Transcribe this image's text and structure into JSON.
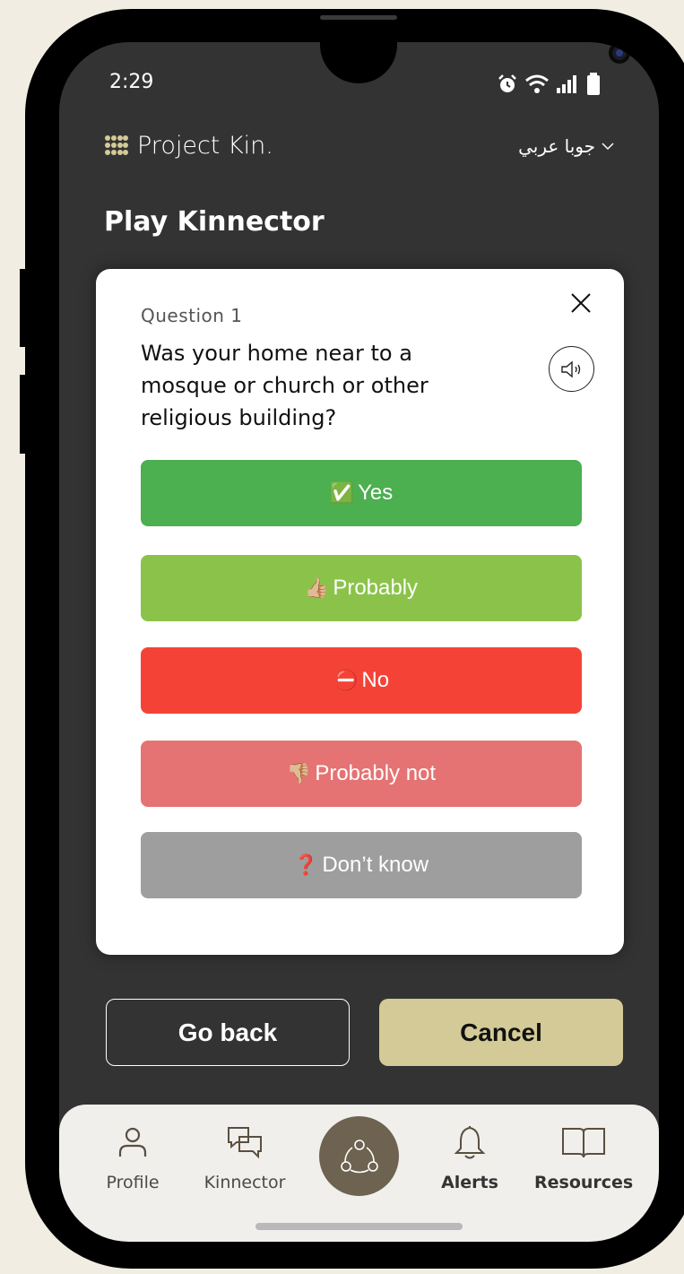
{
  "status_bar": {
    "time": "2:29",
    "icons": [
      "alarm-icon",
      "wifi-icon",
      "signal-icon",
      "battery-icon"
    ]
  },
  "header": {
    "brand": "Project Kin.",
    "language": "جوبا عربي"
  },
  "page": {
    "title": "Play Kinnector"
  },
  "question_card": {
    "label": "Question 1",
    "text": "Was your home near to a mosque or church or other religious building?",
    "answers": [
      {
        "emoji": "✅",
        "label": "Yes",
        "color": "#4caf50"
      },
      {
        "emoji": "👍🏼",
        "label": "Probably",
        "color": "#8bc34a"
      },
      {
        "emoji": "⛔",
        "label": "No",
        "color": "#f44336"
      },
      {
        "emoji": "👎🏼",
        "label": "Probably not",
        "color": "#e57373"
      },
      {
        "emoji": "❓",
        "label": "Don’t know",
        "color": "#9e9e9e"
      }
    ]
  },
  "actions": {
    "back_label": "Go back",
    "cancel_label": "Cancel"
  },
  "tabbar": {
    "items": [
      {
        "label": "Profile",
        "icon": "person-icon"
      },
      {
        "label": "Kinnector",
        "icon": "chat-icon"
      },
      {
        "label": "",
        "icon": "network-icon"
      },
      {
        "label": "Alerts",
        "icon": "bell-icon"
      },
      {
        "label": "Resources",
        "icon": "book-icon"
      }
    ]
  },
  "colors": {
    "background": "#333333",
    "accent": "#d3ca97",
    "center_tab": "#6e6250"
  }
}
